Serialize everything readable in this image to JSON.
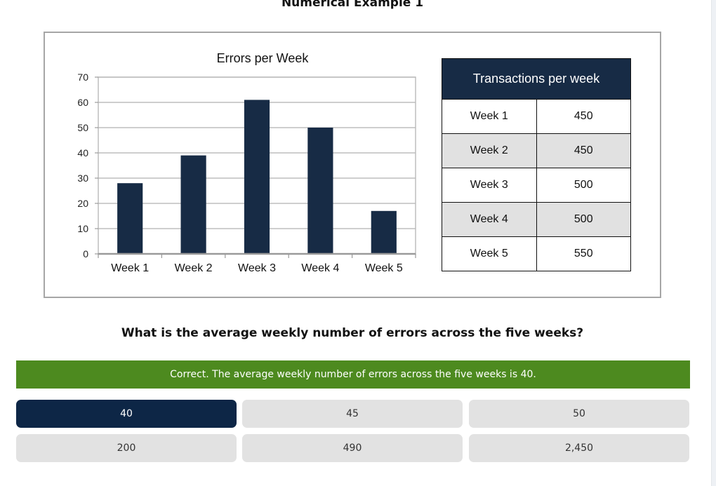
{
  "page": {
    "title": "Numerical Example 1"
  },
  "chart_data": {
    "type": "bar",
    "title": "Errors per Week",
    "categories": [
      "Week 1",
      "Week 2",
      "Week 3",
      "Week 4",
      "Week 5"
    ],
    "values": [
      28,
      39,
      61,
      50,
      17
    ],
    "ylim": [
      0,
      70
    ],
    "yticks": [
      0,
      10,
      20,
      30,
      40,
      50,
      60,
      70
    ],
    "grid": true,
    "bar_color": "#172b45"
  },
  "table": {
    "header": "Transactions per week",
    "rows": [
      {
        "label": "Week 1",
        "value": "450"
      },
      {
        "label": "Week 2",
        "value": "450"
      },
      {
        "label": "Week 3",
        "value": "500"
      },
      {
        "label": "Week 4",
        "value": "500"
      },
      {
        "label": "Week 5",
        "value": "550"
      }
    ]
  },
  "question": "What is the average weekly number of errors across the five weeks?",
  "feedback": "Correct. The average weekly number of errors across the five weeks is 40.",
  "answers": [
    {
      "label": "40",
      "selected": true
    },
    {
      "label": "45",
      "selected": false
    },
    {
      "label": "50",
      "selected": false
    },
    {
      "label": "200",
      "selected": false
    },
    {
      "label": "490",
      "selected": false
    },
    {
      "label": "2,450",
      "selected": false
    }
  ],
  "colors": {
    "accent": "#0d2646",
    "correct": "#4d8a1f",
    "answer_bg": "#e2e2e2"
  }
}
